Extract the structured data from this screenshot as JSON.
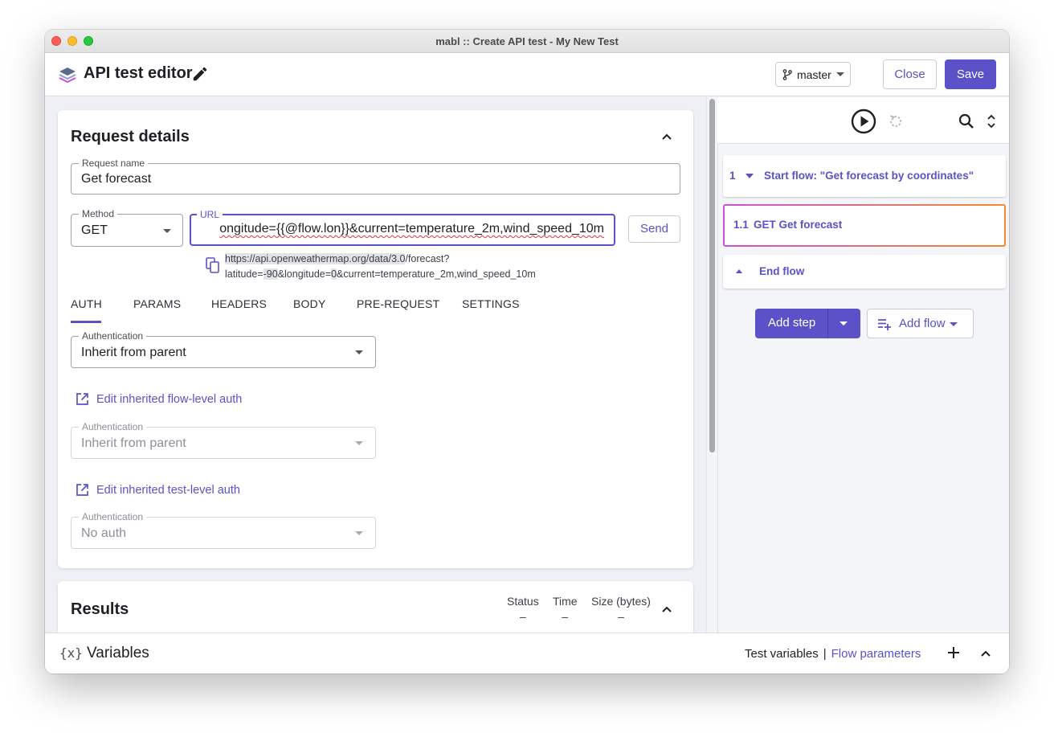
{
  "window": {
    "title": "mabl :: Create API test - My New Test"
  },
  "header": {
    "title": "API test editor",
    "branch": "master",
    "close_label": "Close",
    "save_label": "Save"
  },
  "request": {
    "section_title": "Request details",
    "name_label": "Request name",
    "name_value": "Get forecast",
    "method_label": "Method",
    "method_value": "GET",
    "url_label": "URL",
    "url_value": "ongitude={{@flow.lon}}&current=temperature_2m,wind_speed_10m",
    "send_label": "Send",
    "preview_line1_highlight": "https://api.openweathermap.org/data/3.0",
    "preview_line1_rest": "/forecast?",
    "preview_line2_a": "latitude=",
    "preview_line2_b": "-90",
    "preview_line2_c": "&longitude=",
    "preview_line2_d": "0",
    "preview_line2_e": "&current=temperature_2m,wind_speed_10m"
  },
  "tabs": [
    {
      "label": "AUTH",
      "active": true
    },
    {
      "label": "PARAMS",
      "active": false
    },
    {
      "label": "HEADERS",
      "active": false
    },
    {
      "label": "BODY",
      "active": false
    },
    {
      "label": "PRE-REQUEST",
      "active": false
    },
    {
      "label": "SETTINGS",
      "active": false
    }
  ],
  "auth": {
    "field_label": "Authentication",
    "value": "Inherit from parent",
    "flow_link": "Edit inherited flow-level auth",
    "flow_auth_label": "Authentication",
    "flow_auth_value": "Inherit from parent",
    "test_link": "Edit inherited test-level auth",
    "test_auth_label": "Authentication",
    "test_auth_value": "No auth"
  },
  "results": {
    "title": "Results",
    "columns": [
      {
        "label": "Status",
        "value": "–"
      },
      {
        "label": "Time",
        "value": "–"
      },
      {
        "label": "Size (bytes)",
        "value": "–"
      }
    ]
  },
  "steps": [
    {
      "number": "1",
      "label": "Start flow: \"Get forecast by coordinates\""
    },
    {
      "number": "1.1",
      "label": "GET Get forecast"
    },
    {
      "number": "",
      "label": "End flow"
    }
  ],
  "actions": {
    "add_step": "Add step",
    "add_flow": "Add flow"
  },
  "variables": {
    "icon_text": "{x}",
    "title": "Variables",
    "test_variables": "Test variables",
    "separator": "|",
    "flow_parameters": "Flow parameters"
  },
  "colors": {
    "accent": "#5b52c9",
    "step_highlight_start": "#c553d6",
    "step_highlight_end": "#f28b2c"
  }
}
